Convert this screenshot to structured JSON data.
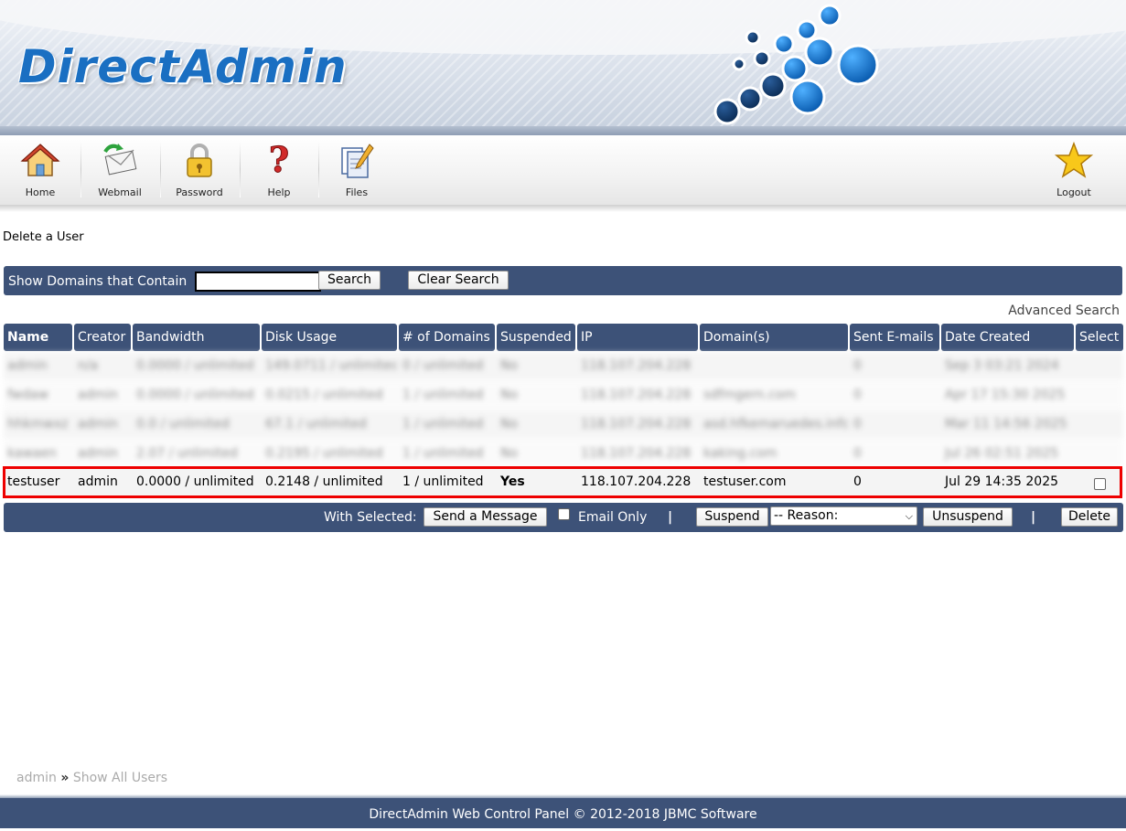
{
  "brand": {
    "logo_text": "DirectAdmin"
  },
  "toolbar": {
    "items": [
      {
        "label": "Home",
        "icon": "home-icon"
      },
      {
        "label": "Webmail",
        "icon": "mail-icon"
      },
      {
        "label": "Password",
        "icon": "lock-icon"
      },
      {
        "label": "Help",
        "icon": "help-icon"
      },
      {
        "label": "Files",
        "icon": "files-icon"
      }
    ],
    "logout": {
      "label": "Logout",
      "icon": "star-icon"
    }
  },
  "page": {
    "title": "Delete a User"
  },
  "search": {
    "label": "Show Domains that Contain",
    "value": "",
    "search_button": "Search",
    "clear_button": "Clear Search",
    "advanced_link": "Advanced Search"
  },
  "table": {
    "columns": [
      "Name",
      "Creator",
      "Bandwidth",
      "Disk Usage",
      "# of Domains",
      "Suspended",
      "IP",
      "Domain(s)",
      "Sent E-mails",
      "Date Created",
      "Select"
    ],
    "blurred_rows": [
      [
        "admin",
        "n/a",
        "0.0000 / unlimited",
        "149.0711 / unlimited",
        "0 / unlimited",
        "No",
        "118.107.204.228",
        "",
        "0",
        "Sep 3 03:21 2024",
        ""
      ],
      [
        "fwdaw",
        "admin",
        "0.0000 / unlimited",
        "0.0215 / unlimited",
        "1 / unlimited",
        "No",
        "118.107.204.228",
        "sdfmgern.com",
        "0",
        "Apr 17 15:30 2025",
        ""
      ],
      [
        "hhkmwxz",
        "admin",
        "0.0 / unlimited",
        "67.1 / unlimited",
        "1 / unlimited",
        "No",
        "118.107.204.228",
        "asd.hfkemaruedes.info",
        "0",
        "Mar 11 14:56 2025",
        ""
      ],
      [
        "kawaen",
        "admin",
        "2.07 / unlimited",
        "0.2195 / unlimited",
        "1 / unlimited",
        "No",
        "118.107.204.228",
        "kaking.com",
        "0",
        "Jul 26 02:51 2025",
        ""
      ]
    ],
    "highlight_row": {
      "name": "testuser",
      "creator": "admin",
      "bandwidth": "0.0000 / unlimited",
      "disk_usage": "0.2148 / unlimited",
      "domains_count": "1 / unlimited",
      "suspended": "Yes",
      "ip": "118.107.204.228",
      "domains": "testuser.com",
      "sent_emails": "0",
      "date_created": "Jul 29 14:35 2025"
    }
  },
  "actions": {
    "with_selected_label": "With Selected:",
    "send_message": "Send a Message",
    "email_only": "Email Only",
    "divider": "|",
    "suspend": "Suspend",
    "reason_selected": "-- Reason:",
    "unsuspend": "Unsuspend",
    "delete": "Delete"
  },
  "breadcrumb": {
    "user": "admin",
    "sep": "»",
    "link": "Show All Users"
  },
  "footer": {
    "text": "DirectAdmin Web Control Panel © 2012-2018 JBMC Software"
  },
  "colors": {
    "header_blue": "#3d5278",
    "suspended_red": "#e00000",
    "highlight_border": "#ee0000"
  }
}
